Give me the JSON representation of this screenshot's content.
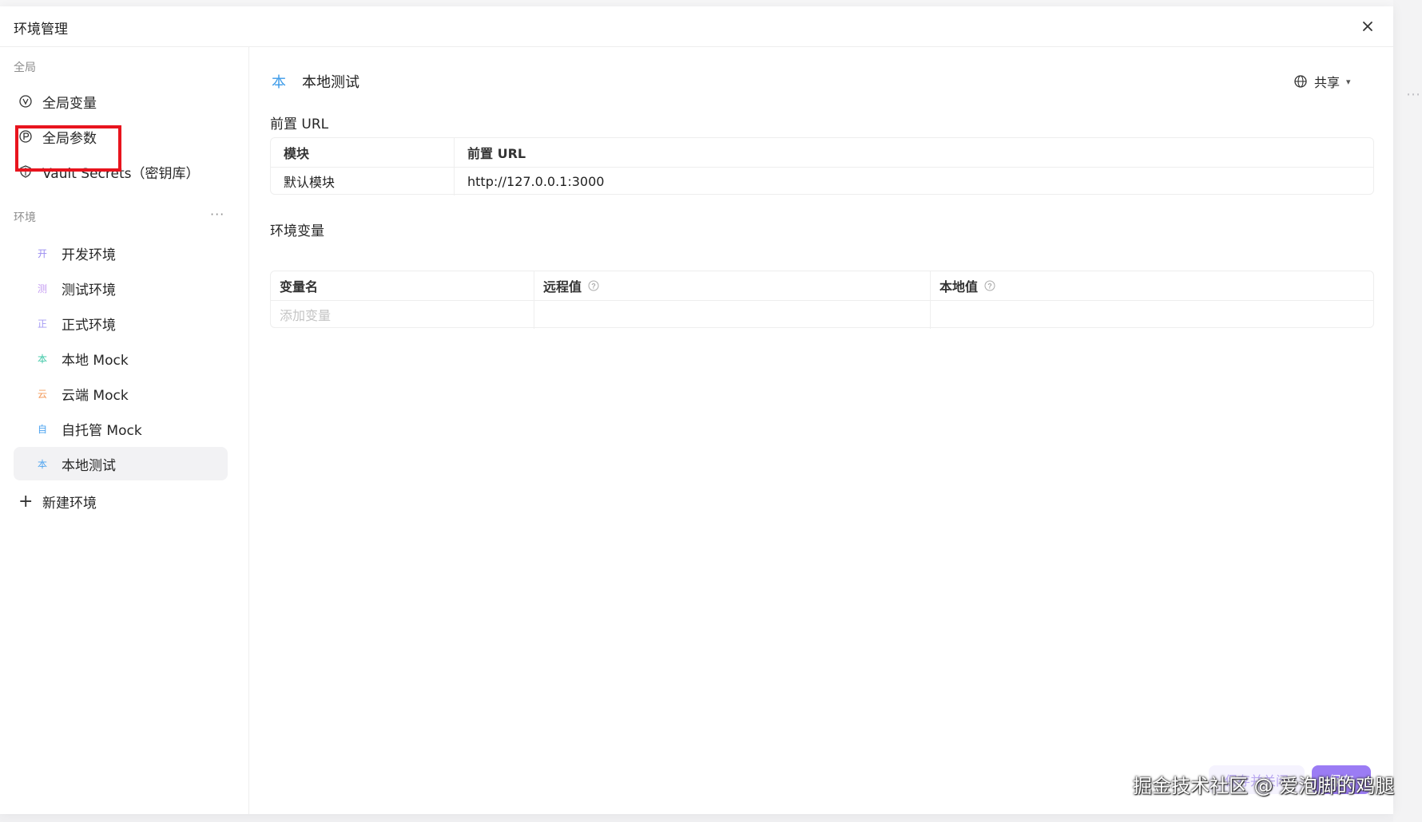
{
  "modal": {
    "title": "环境管理",
    "close_label": "×"
  },
  "sidebar": {
    "global_label": "全局",
    "global_items": [
      {
        "label": "全局变量",
        "icon": "v-circle-icon"
      },
      {
        "label": "全局参数",
        "icon": "p-circle-icon"
      },
      {
        "label": "Vault Secrets（密钥库）",
        "icon": "shield-icon"
      }
    ],
    "env_label": "环境",
    "more_label": "···",
    "environments": [
      {
        "badge": "开",
        "label": "开发环境",
        "color": "#9b8df0"
      },
      {
        "badge": "测",
        "label": "测试环境",
        "color": "#c59cf2"
      },
      {
        "badge": "正",
        "label": "正式环境",
        "color": "#a49af3"
      },
      {
        "badge": "本",
        "label": "本地 Mock",
        "color": "#3cc7a6"
      },
      {
        "badge": "云",
        "label": "云端 Mock",
        "color": "#f39a5a"
      },
      {
        "badge": "自",
        "label": "自托管 Mock",
        "color": "#4ea4f0"
      },
      {
        "badge": "本",
        "label": "本地测试",
        "color": "#4ea4f0"
      }
    ],
    "new_env_label": "新建环境"
  },
  "main": {
    "env_badge": "本",
    "env_name": "本地测试",
    "share_label": "共享",
    "prefix_url_title": "前置 URL",
    "url_table": {
      "headers": [
        "模块",
        "前置 URL"
      ],
      "rows": [
        [
          "默认模块",
          "http://127.0.0.1:3000"
        ]
      ]
    },
    "env_vars_title": "环境变量",
    "var_table": {
      "headers": [
        "变量名",
        "远程值",
        "本地值"
      ],
      "placeholder": "添加变量"
    }
  },
  "footer": {
    "save_close_label": "保存并关闭",
    "save_label": "保存"
  },
  "watermark": "掘金技术社区 @ 爱泡脚的鸡腿",
  "colors": {
    "highlight": "#e8141e",
    "primary": "#9b7cf4",
    "active_bg": "#f2f2f4"
  }
}
